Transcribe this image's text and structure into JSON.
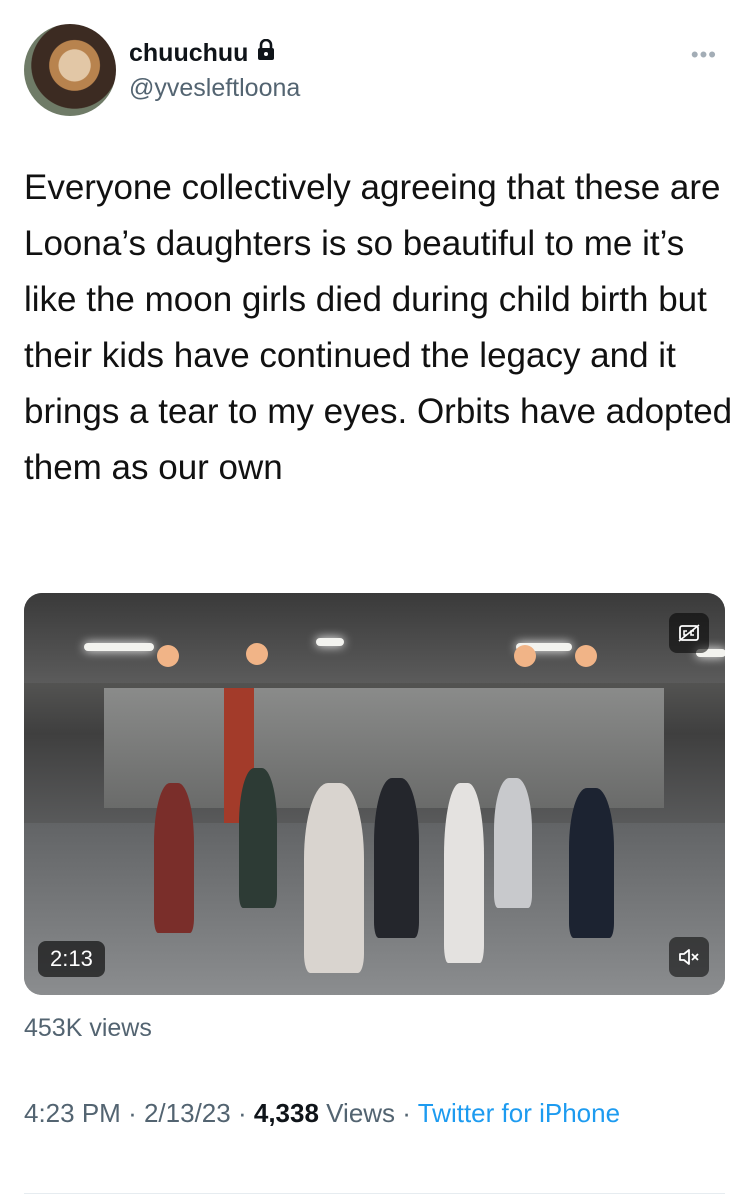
{
  "author": {
    "display_name": "chuuchuu",
    "handle": "@yvesleftloona",
    "protected_icon": "lock-icon"
  },
  "tweet": {
    "text": "Everyone collectively agreeing that these are Loona’s daughters is so beautiful to me it’s like the moon girls died during child birth but their kids have continued the legacy and it brings a tear to my eyes. Orbits have adopted them as our own"
  },
  "media": {
    "duration": "2:13",
    "views_label": "453K views",
    "captions_icon": "closed-captions-icon",
    "mute_icon": "speaker-muted-icon"
  },
  "meta": {
    "time": "4:23 PM",
    "sep": "·",
    "date": "2/13/23",
    "views_count": "4,338",
    "views_word": "Views",
    "source": "Twitter for iPhone"
  },
  "colors": {
    "text": "#0f1419",
    "secondary": "#536471",
    "link": "#1d9bf0"
  }
}
